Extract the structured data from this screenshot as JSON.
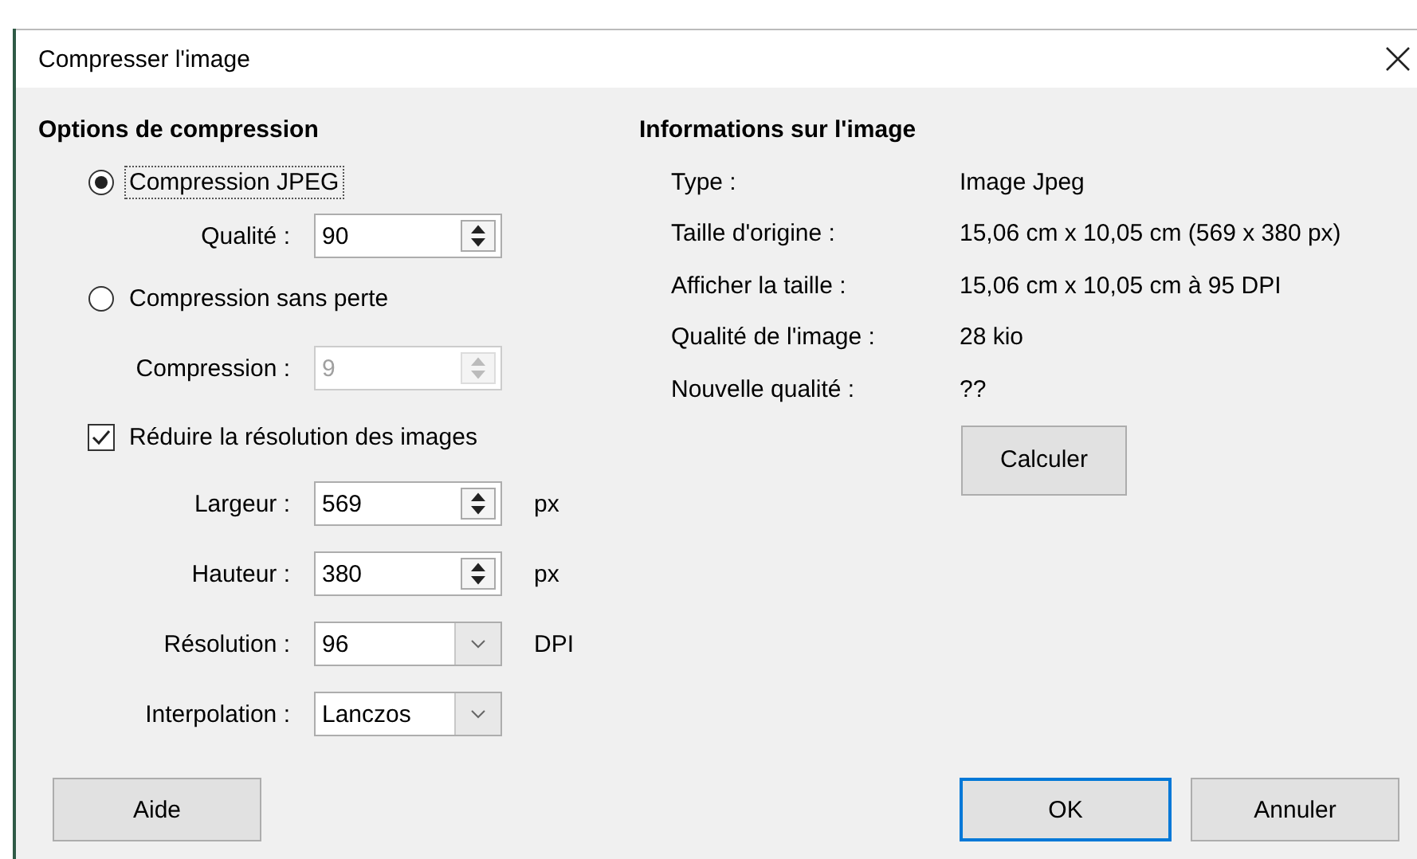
{
  "window": {
    "title": "Compresser l'image"
  },
  "compression_options": {
    "heading": "Options de compression",
    "items": [
      {
        "kind": "radio",
        "label": "Compression JPEG",
        "selected": true,
        "focused": true
      },
      {
        "kind": "spin",
        "label": "Qualité :",
        "value": "90",
        "disabled": false
      },
      {
        "kind": "radio",
        "label": "Compression sans perte",
        "selected": false,
        "focused": false
      },
      {
        "kind": "spin",
        "label": "Compression :",
        "value": "9",
        "disabled": true
      },
      {
        "kind": "checkbox",
        "label": "Réduire la résolution des images",
        "checked": true
      },
      {
        "kind": "spin",
        "label": "Largeur :",
        "value": "569",
        "disabled": false,
        "unit": "px"
      },
      {
        "kind": "spin",
        "label": "Hauteur :",
        "value": "380",
        "disabled": false,
        "unit": "px"
      },
      {
        "kind": "dropdown",
        "label": "Résolution :",
        "value": "96",
        "disabled": false,
        "unit": "DPI"
      },
      {
        "kind": "dropdown",
        "label": "Interpolation :",
        "value": "Lanczos",
        "disabled": false
      }
    ]
  },
  "image_info": {
    "heading": "Informations sur l'image",
    "rows": [
      {
        "label": "Type :",
        "value": "Image Jpeg"
      },
      {
        "label": "Taille d'origine :",
        "value": "15,06 cm x 10,05 cm (569 x 380 px)"
      },
      {
        "label": "Afficher la taille :",
        "value": "15,06 cm x 10,05 cm à 95 DPI"
      },
      {
        "label": "Qualité de l'image :",
        "value": "28 kio"
      },
      {
        "label": "Nouvelle qualité :",
        "value": "??"
      }
    ],
    "button": {
      "label": "Calculer"
    }
  },
  "help_button": {
    "label": "Aide"
  },
  "buttons": [
    {
      "label": "OK",
      "default": true
    },
    {
      "label": "Annuler",
      "default": false
    }
  ]
}
